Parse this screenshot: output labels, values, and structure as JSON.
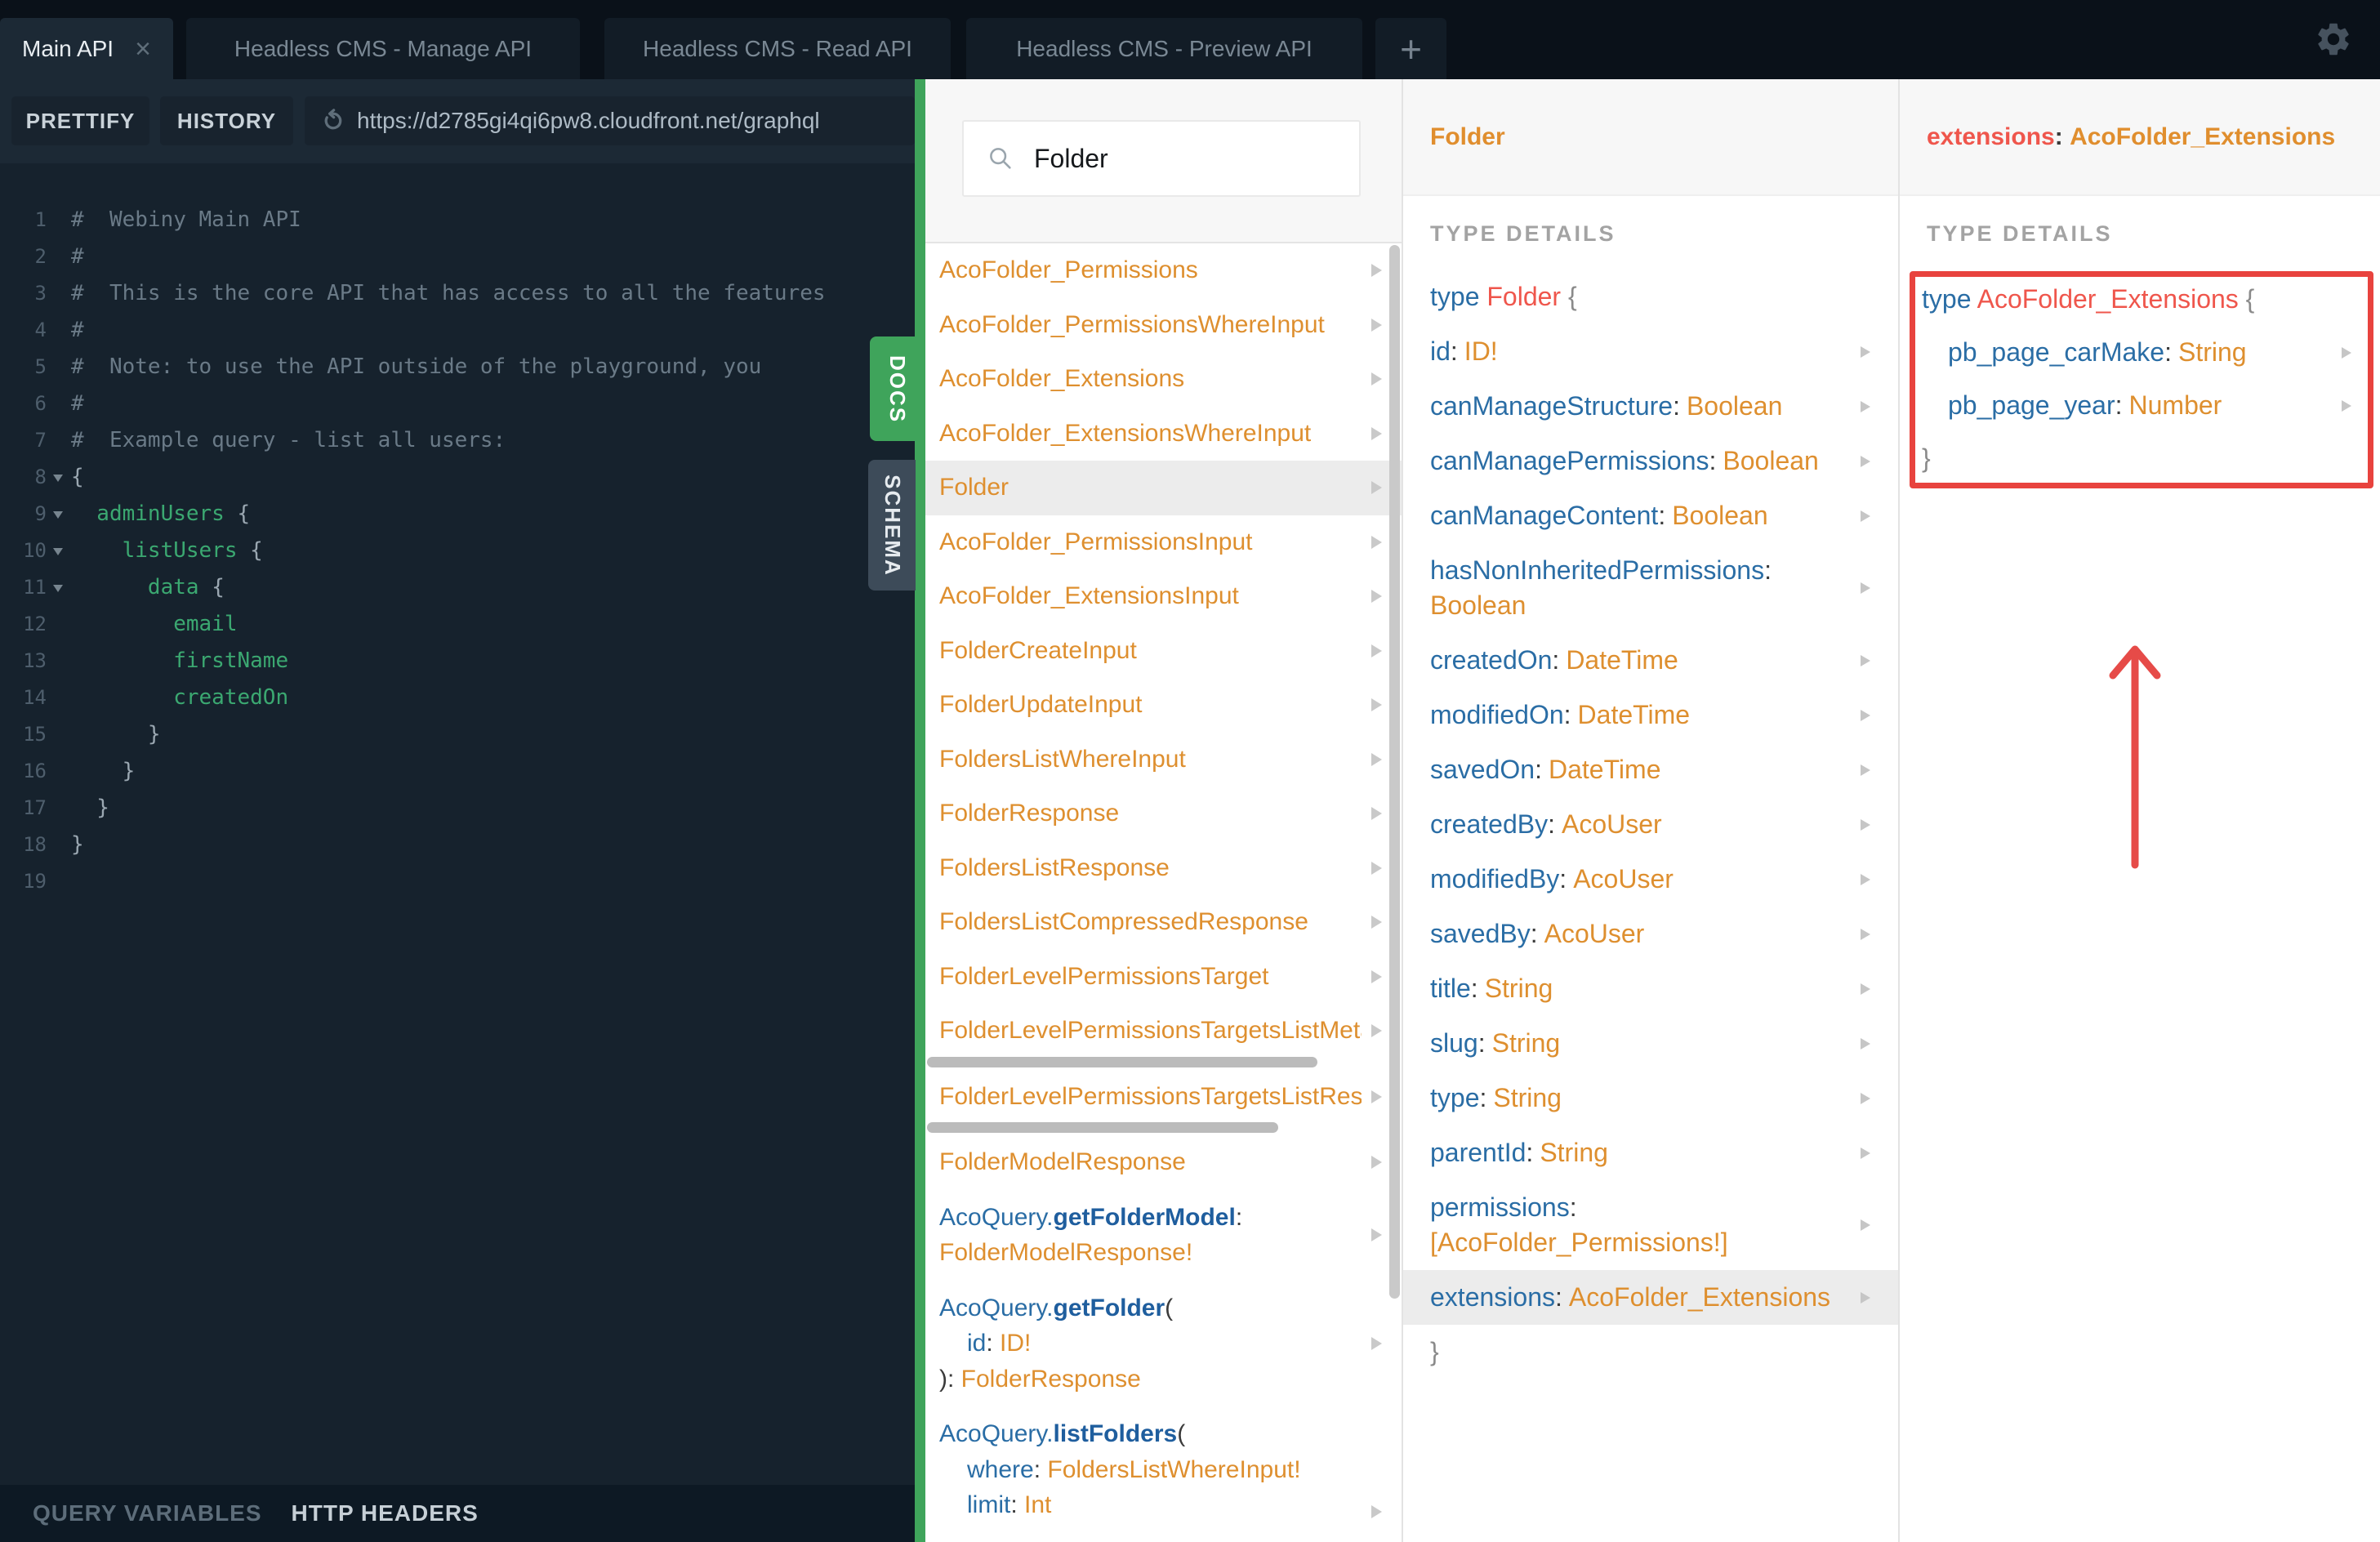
{
  "colors": {
    "accent_green": "#3FA45B",
    "type_orange": "#DE8F2F",
    "field_blue": "#2A6DA5",
    "type_red": "#EF564C",
    "annotation_red": "#E8433E",
    "editor_bg": "#16222D",
    "topbar_bg": "#0A1119"
  },
  "icons": {
    "close": "×",
    "plus": "+"
  },
  "tabs": {
    "items": [
      {
        "label": "Main API"
      },
      {
        "label": "Headless CMS - Manage API"
      },
      {
        "label": "Headless CMS - Read API"
      },
      {
        "label": "Headless CMS - Preview API"
      }
    ]
  },
  "toolbar": {
    "prettify": "PRETTIFY",
    "history": "HISTORY",
    "url": "https://d2785gi4qi6pw8.cloudfront.net/graphql"
  },
  "editor": {
    "lines": [
      {
        "n": "1",
        "c": "#  Webiny Main API"
      },
      {
        "n": "2",
        "c": "#"
      },
      {
        "n": "3",
        "c": "#  This is the core API that has access to all the features"
      },
      {
        "n": "4",
        "c": "#"
      },
      {
        "n": "5",
        "c": "#  Note: to use the API outside of the playground, you"
      },
      {
        "n": "6",
        "c": "#"
      },
      {
        "n": "7",
        "c": "#  Example query - list all users:"
      },
      {
        "n": "8",
        "fold": true,
        "p": "{"
      },
      {
        "n": "9",
        "fold": true,
        "g": "  adminUsers ",
        "p": "{"
      },
      {
        "n": "10",
        "fold": true,
        "g": "    listUsers ",
        "p": "{"
      },
      {
        "n": "11",
        "fold": true,
        "g": "      data ",
        "p": "{"
      },
      {
        "n": "12",
        "g": "        email"
      },
      {
        "n": "13",
        "g": "        firstName"
      },
      {
        "n": "14",
        "g": "        createdOn"
      },
      {
        "n": "15",
        "p": "      }"
      },
      {
        "n": "16",
        "p": "    }"
      },
      {
        "n": "17",
        "p": "  }"
      },
      {
        "n": "18",
        "p": "}"
      },
      {
        "n": "19"
      }
    ]
  },
  "footer": {
    "query_variables": "QUERY VARIABLES",
    "http_headers": "HTTP HEADERS"
  },
  "side_tabs": {
    "docs": "DOCS",
    "schema": "SCHEMA"
  },
  "docs": {
    "search_value": "Folder",
    "items": [
      {
        "label": "AcoFolder_Permissions"
      },
      {
        "label": "AcoFolder_PermissionsWhereInput"
      },
      {
        "label": "AcoFolder_Extensions"
      },
      {
        "label": "AcoFolder_ExtensionsWhereInput"
      },
      {
        "label": "Folder",
        "selected": true
      },
      {
        "label": "AcoFolder_PermissionsInput"
      },
      {
        "label": "AcoFolder_ExtensionsInput"
      },
      {
        "label": "FolderCreateInput"
      },
      {
        "label": "FolderUpdateInput"
      },
      {
        "label": "FoldersListWhereInput"
      },
      {
        "label": "FolderResponse"
      },
      {
        "label": "FoldersListResponse"
      },
      {
        "label": "FoldersListCompressedResponse"
      },
      {
        "label": "FolderLevelPermissionsTarget"
      },
      {
        "label": "FolderLevelPermissionsTargetsListMeta",
        "hscroll": true
      },
      {
        "label": "FolderLevelPermissionsTargetsListResponse",
        "hscroll": true,
        "hscroll2": true
      },
      {
        "label": "FolderModelResponse"
      }
    ],
    "queries": {
      "q1": {
        "ns": "AcoQuery.",
        "name": "getFolderModel",
        "sep": ":",
        "ret": "FolderModelResponse!"
      },
      "q2": {
        "ns": "AcoQuery.",
        "name": "getFolder",
        "open": "(",
        "arg1_name": "id",
        "arg1_sep": ":",
        "arg1_type": "ID!",
        "close": "):",
        "ret": "FolderResponse"
      },
      "q3": {
        "ns": "AcoQuery.",
        "name": "listFolders",
        "open": "(",
        "arg1_name": "where",
        "arg1_sep": ":",
        "arg1_type": "FoldersListWhereInput!",
        "arg2_name": "limit",
        "arg2_sep": ":",
        "arg2_type": "Int"
      }
    }
  },
  "panel1": {
    "title": "Folder",
    "section": "TYPE DETAILS",
    "sep": ":",
    "decl": {
      "keyword": "type",
      "name": "Folder",
      "open": "{",
      "close": "}"
    },
    "fields": [
      {
        "name": "id",
        "type": "ID!"
      },
      {
        "name": "canManageStructure",
        "type": "Boolean"
      },
      {
        "name": "canManagePermissions",
        "type": "Boolean"
      },
      {
        "name": "canManageContent",
        "type": "Boolean"
      },
      {
        "name": "hasNonInheritedPermissions",
        "type": "Boolean",
        "wrap": true
      },
      {
        "name": "createdOn",
        "type": "DateTime"
      },
      {
        "name": "modifiedOn",
        "type": "DateTime"
      },
      {
        "name": "savedOn",
        "type": "DateTime"
      },
      {
        "name": "createdBy",
        "type": "AcoUser"
      },
      {
        "name": "modifiedBy",
        "type": "AcoUser"
      },
      {
        "name": "savedBy",
        "type": "AcoUser"
      },
      {
        "name": "title",
        "type": "String"
      },
      {
        "name": "slug",
        "type": "String"
      },
      {
        "name": "type",
        "type": "String"
      },
      {
        "name": "parentId",
        "type": "String"
      },
      {
        "name": "permissions",
        "type": "[AcoFolder_Permissions!]",
        "wrap": true
      },
      {
        "name": "extensions",
        "type": "AcoFolder_Extensions",
        "selected": true
      }
    ]
  },
  "panel2": {
    "title_field": "extensions",
    "title_sep": ":",
    "title_type": "AcoFolder_Extensions",
    "section": "TYPE DETAILS",
    "sep": ":",
    "decl": {
      "keyword": "type",
      "name": "AcoFolder_Extensions",
      "open": "{",
      "close": "}"
    },
    "fields": [
      {
        "name": "pb_page_carMake",
        "type": "String"
      },
      {
        "name": "pb_page_year",
        "type": "Number"
      }
    ]
  }
}
